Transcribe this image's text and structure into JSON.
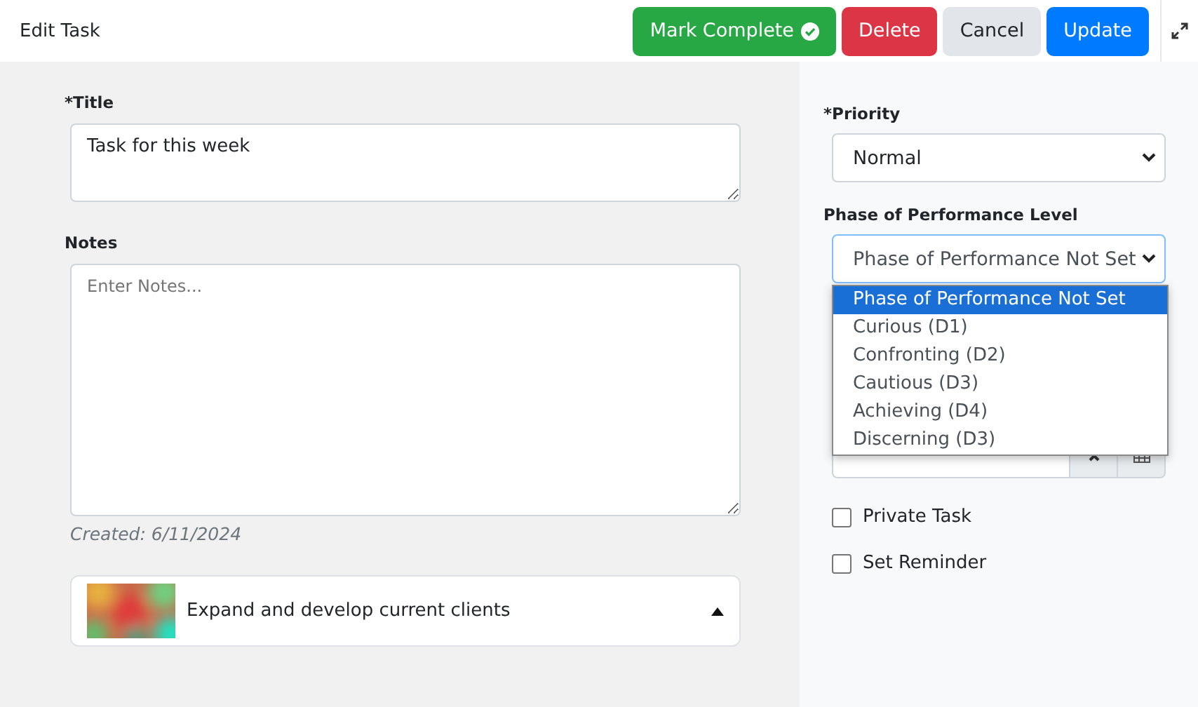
{
  "header": {
    "title": "Edit Task",
    "buttons": [
      {
        "kind": "success",
        "label": "Mark Complete",
        "icon": true
      },
      {
        "kind": "danger",
        "label": "Delete"
      },
      {
        "kind": "secondary",
        "label": "Cancel"
      },
      {
        "kind": "primary",
        "label": "Update"
      }
    ]
  },
  "form": {
    "title_label": "*Title",
    "title_value": "Task for this week",
    "notes_label": "Notes",
    "notes_placeholder": "Enter Notes...",
    "created": "Created: 6/11/2024"
  },
  "goal": {
    "kind": "picture",
    "text": "Expand and develop current clients",
    "expanded": true
  },
  "side": {
    "priority_label": "*Priority",
    "priority_value": "Normal",
    "phase_label": "Phase of Performance Level",
    "phase_value": "Phase of Performance Not Set",
    "phase_open": true,
    "phase_options": [
      {
        "label": "Phase of Performance Not Set",
        "selected": true
      },
      {
        "label": "Curious (D1)",
        "selected": false
      },
      {
        "label": "Confronting (D2)",
        "selected": false
      },
      {
        "label": "Cautious (D3)",
        "selected": false
      },
      {
        "label": "Achieving (D4)",
        "selected": false
      },
      {
        "label": "Discerning (D3)",
        "selected": false
      }
    ],
    "checkboxes": [
      {
        "label": "Private Task",
        "checked": false
      },
      {
        "label": "Set Reminder",
        "checked": false
      }
    ]
  }
}
